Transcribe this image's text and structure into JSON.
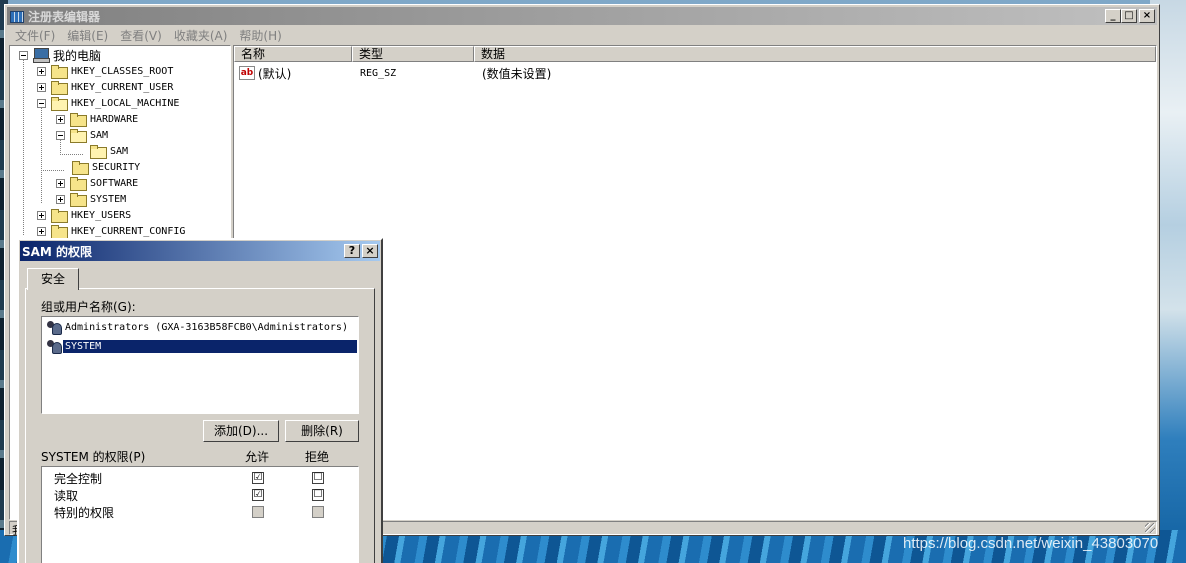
{
  "regedit": {
    "title": "注册表编辑器",
    "menu": [
      "文件(F)",
      "编辑(E)",
      "查看(V)",
      "收藏夹(A)",
      "帮助(H)"
    ],
    "caption_buttons": {
      "minimize": "_",
      "maximize": "□",
      "close": "×"
    },
    "tree": {
      "root": "我的电脑",
      "items": [
        {
          "label": "HKEY_CLASSES_ROOT"
        },
        {
          "label": "HKEY_CURRENT_USER"
        },
        {
          "label": "HKEY_LOCAL_MACHINE"
        },
        {
          "label": "HARDWARE"
        },
        {
          "label": "SAM"
        },
        {
          "label": "SAM"
        },
        {
          "label": "SECURITY"
        },
        {
          "label": "SOFTWARE"
        },
        {
          "label": "SYSTEM"
        },
        {
          "label": "HKEY_USERS"
        },
        {
          "label": "HKEY_CURRENT_CONFIG"
        }
      ]
    },
    "list": {
      "columns": [
        "名称",
        "类型",
        "数据"
      ],
      "rows": [
        {
          "icon": "ab",
          "name": "(默认)",
          "type": "REG_SZ",
          "data": "(数值未设置)"
        }
      ]
    },
    "statusbar": {
      "text": "我"
    }
  },
  "dialog": {
    "title": "SAM 的权限",
    "help_button": "?",
    "close_button": "×",
    "tab": "安全",
    "group_label": "组或用户名称(G):",
    "users": [
      {
        "name": "Administrators (GXA-3163B58FCB0\\Administrators)"
      },
      {
        "name": "SYSTEM"
      }
    ],
    "add_button": "添加(D)...",
    "remove_button": "删除(R)",
    "perm_label": "SYSTEM 的权限(P)",
    "allow_header": "允许",
    "deny_header": "拒绝",
    "permissions": [
      {
        "name": "完全控制",
        "allow": "☑",
        "deny": "☐"
      },
      {
        "name": "读取",
        "allow": "☑",
        "deny": "☐"
      },
      {
        "name": "特别的权限",
        "allow": "",
        "deny": ""
      }
    ]
  },
  "watermark": "https://blog.csdn.net/weixin_43803070"
}
